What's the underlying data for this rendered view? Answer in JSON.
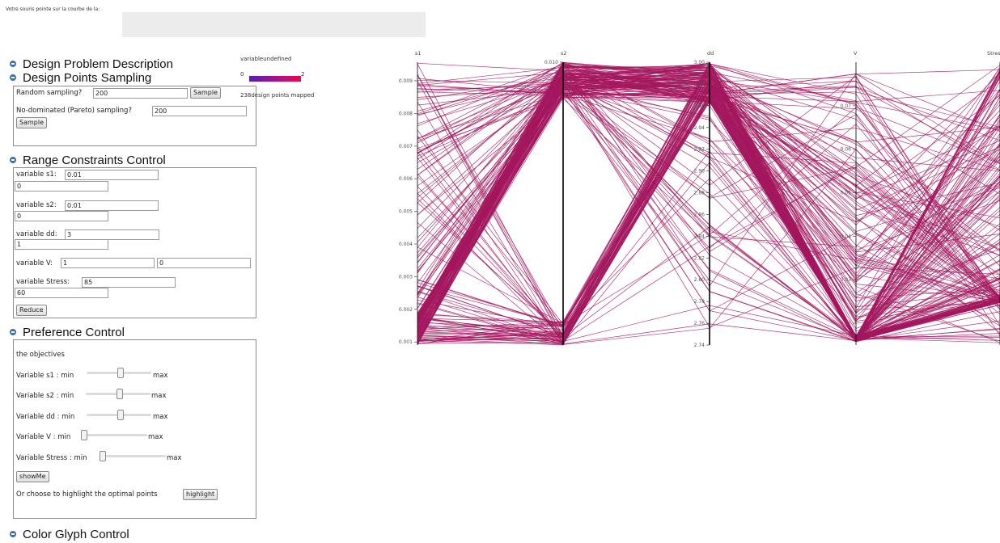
{
  "hover": {
    "label": "Votre souris pointe sur la courbe de la:"
  },
  "sections": {
    "design_problem": "Design Problem Description",
    "sampling": "Design Points Sampling",
    "range": "Range Constraints Control",
    "preference": "Preference Control",
    "color_glyph": "Color Glyph Control"
  },
  "sampling_panel": {
    "random_label": "Random sampling?",
    "random_value": "200",
    "random_button": "Sample",
    "pareto_label": "No-dominated (Pareto) sampling?",
    "pareto_value": "200",
    "pareto_button": "Sample"
  },
  "range_panel": {
    "variables": [
      {
        "label": "variable s1:",
        "max": "0.01",
        "min": "0"
      },
      {
        "label": "variable s2:",
        "max": "0.01",
        "min": "0"
      },
      {
        "label": "variable dd:",
        "max": "3",
        "min": "1"
      },
      {
        "label": "variable V:",
        "max": "1",
        "min": "0"
      },
      {
        "label": "variable Stress:",
        "max": "85",
        "min": "60"
      }
    ],
    "reduce_button": "Reduce"
  },
  "preference_panel": {
    "heading": "the objectives",
    "rows": [
      {
        "label": "Variable s1 : min",
        "max": "max",
        "level": 0.5
      },
      {
        "label": "Variable s2 : min",
        "max": "max",
        "level": 0.5
      },
      {
        "label": "Variable dd : min",
        "max": "max",
        "level": 0.5
      },
      {
        "label": "Variable V : min",
        "max": "max",
        "level": 0.0
      },
      {
        "label": "Variable Stress : min",
        "max": "max",
        "level": 0.0
      }
    ],
    "show_button": "showMe",
    "highlight_text": "Or choose to highlight the optimal points",
    "highlight_button": "highlight"
  },
  "legend": {
    "title": "variableundefined",
    "min": "0",
    "max": "2",
    "mapped": "238design points mapped",
    "colors": [
      "#5b1fb3",
      "#6a1aa8",
      "#7a1aa0",
      "#8b1797",
      "#9c1490",
      "#ac1185",
      "#bc0f7a",
      "#cb0d6c",
      "#d60a5e",
      "#e00a4c"
    ]
  },
  "chart_data": {
    "type": "parallel-coordinates",
    "line_color": "#a3185f",
    "axes": [
      {
        "name": "s1",
        "range": [
          0.001,
          0.0096
        ],
        "ticks": [
          "0.009",
          "0.008",
          "0.007",
          "0.006",
          "0.005",
          "0.004",
          "0.003",
          "0.002",
          "0.001"
        ]
      },
      {
        "name": "s2",
        "range": [
          0.001,
          0.01
        ],
        "ticks": [
          "0.010"
        ]
      },
      {
        "name": "dd",
        "range": [
          2.74,
          3.0
        ],
        "ticks": [
          "3.00",
          "2.98",
          "2.96",
          "2.94",
          "2.92",
          "2.90",
          "2.88",
          "2.86",
          "2.84",
          "2.82",
          "2.80",
          "2.78",
          "2.76",
          "2.74"
        ]
      },
      {
        "name": "V",
        "range": [
          0.015,
          0.08
        ],
        "ticks": [
          "0.07",
          "0.06",
          "0.05",
          "0.04",
          "0.03",
          "0.02"
        ]
      },
      {
        "name": "Stress",
        "range": [
          84,
          85.5
        ],
        "ticks": []
      }
    ],
    "shown_lines": 238
  }
}
